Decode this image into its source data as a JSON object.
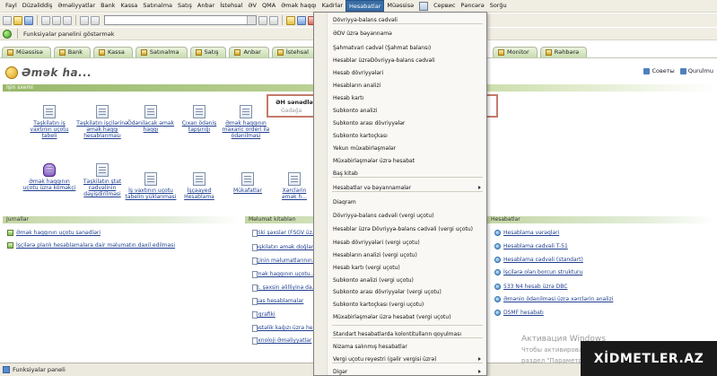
{
  "menubar": {
    "items": [
      "Fayl",
      "Düzəliddiş",
      "Əməliyyatlar",
      "Bank",
      "Kassa",
      "Satınalma",
      "Satış",
      "Anbar",
      "İstehsal",
      "ƏV",
      "QMA",
      "Əmək haqqı",
      "Kadrlar",
      "Hesabatlar",
      "Müəssisə",
      "Сервис",
      "Pəncərə",
      "Sorğu"
    ]
  },
  "toolbar2": {
    "panel_toggle": "Funksiyalar panelini göstərmək"
  },
  "tabs": [
    "Müəssisə",
    "Bank",
    "Kassa",
    "Satınalma",
    "Satış",
    "Anbar",
    "İstehsal",
    "Monitor",
    "Rəhbərə"
  ],
  "page": {
    "title": "Əmək ha...",
    "actions": [
      "Советы",
      "Qurulmu"
    ]
  },
  "work_schema": {
    "header": "İşin sxemi",
    "docs_row1": [
      "Təşkilatın iş vaxtının uçotu tabeli",
      "Təşkilatın işçilərinə əmək haqqı hesablanması",
      "Ödənilacak əmək haqqı",
      "Çıxan ödəniş tapşırığı",
      "Əmək haqqının məxaric orderi ilə ödənilməsi"
    ],
    "docs_row2": [
      "Əmək haqqının uçotu üzrə köməkçi",
      "Təşkilatın ştat cədvəlinin dəyişdirilməsi",
      "İş vaxtının uçotu tabelin yüklənməsi",
      "İşçəayed Hesablama",
      "Mükafatlar",
      "Xərclərin əmək h..."
    ],
    "nested": {
      "title": "ƏH sənədlər",
      "item": "Gədağa"
    }
  },
  "journals": {
    "header": "Jurnallar",
    "items": [
      "Əmək haqqının uçotu sənədləri",
      "İşçilərə planlı hesablamalara dair məlumatın daxil edilməsi"
    ]
  },
  "reference_books": {
    "header": "Məlumat kitabları",
    "items": [
      "Fiziki şəxslər (FSGV üz...",
      "Təşkilatın əmək doğlara...",
      "İşçinin məlumatlarının...",
      "Əmək haqqının uçotu...",
      "Fiz. şəxsin əlilliyinə da...",
      "Əsas hesablamalar",
      "İş qrafiki",
      "Xəstəlik kağızı üzrə he...",
      "Texnoloji Əməliyyatlar"
    ]
  },
  "reports": {
    "header": "Hesabatlar",
    "items": [
      "Hesablama vərəqləri",
      "Hesablama cədvəli T-51",
      "Hesablama cədvəli (standart)",
      "İşçilərə olan borcun strukturu",
      "533 N4 hesab üzrə DBC",
      "Əmənin ödənilməsi üzrə xərclərin analizi",
      "DSMF hesabatı"
    ]
  },
  "dropdown": {
    "items": [
      {
        "label": "Dövriyyə-balans cədvəli"
      },
      {
        "label": "ƏDV üzrə bəyannamə"
      },
      {
        "label": "Şahmatvari cədvəl (Şahmat balansı)"
      },
      {
        "label": "Hesablar üzrəDövriyyə-balans cədvəli"
      },
      {
        "label": "Hesab dövriyyələri"
      },
      {
        "label": "Hesabların analizi"
      },
      {
        "label": "Hesab kartı"
      },
      {
        "label": "Subkonto analizi"
      },
      {
        "label": "Subkonto arası dövriyyələr"
      },
      {
        "label": "Subkonto kartoçkası"
      },
      {
        "label": "Yekun müxabirləşmələr"
      },
      {
        "label": "Müxabirləşmələr üzrə hesabat"
      },
      {
        "label": "Baş kitab"
      },
      {
        "label": "Hesabatlar və bəyannamələr",
        "submenu": true
      },
      {
        "label": "Diaqram"
      },
      {
        "label": "Dövriyyə-balans cədvəli (vergi uçotu)"
      },
      {
        "label": "Hesablar üzrə Dövriyyə-balans cədvəli (vergi uçotu)"
      },
      {
        "label": "Hesab dövriyyələri (vergi uçotu)"
      },
      {
        "label": "Hesabların analizi (vergi uçotu)"
      },
      {
        "label": "Hesab kartı (vergi uçotu)"
      },
      {
        "label": "Subkonto analizi (vergi uçotu)"
      },
      {
        "label": "Subkonto arası dövriyyələr (vergi uçotu)"
      },
      {
        "label": "Subkonto kartoçkası (vergi uçotu)"
      },
      {
        "label": "Müxabirləşmələr üzrə hesabat (vergi uçotu)"
      },
      {
        "label": "Standart hesabatlarda kolontitulların qoyulması"
      },
      {
        "label": "Nizama salınmış hesabatlar"
      },
      {
        "label": "Vergi uçotu reyestri (gəlir vergisi üzrə)",
        "submenu": true
      },
      {
        "label": "Digər",
        "submenu": true
      }
    ]
  },
  "statusbar": {
    "label": "Funksiyalar paneli"
  },
  "watermark": {
    "line1": "Активация Windows",
    "line2": "Чтобы активировать Windows, перейдите в",
    "line3": "раздел \"Параметры\"."
  },
  "brand": "XİDMETLER.AZ"
}
